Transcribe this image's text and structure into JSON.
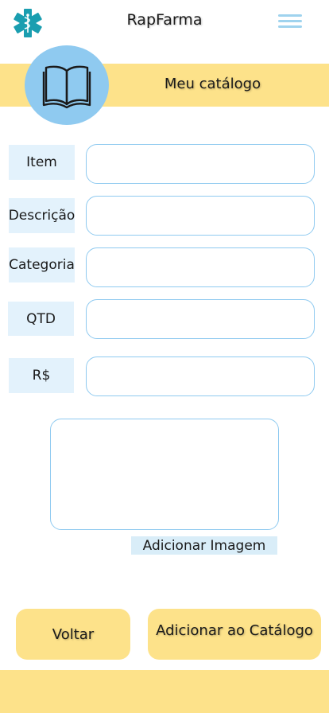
{
  "header": {
    "app_title": "RapFarma",
    "logo_icon": "medical-star-icon",
    "menu_icon": "hamburger-menu-icon"
  },
  "banner": {
    "title": "Meu catálogo",
    "avatar_icon": "open-book-icon"
  },
  "form": {
    "fields": [
      {
        "label": "Item",
        "value": "",
        "placeholder": ""
      },
      {
        "label": "Descrição",
        "value": "",
        "placeholder": ""
      },
      {
        "label": "Categoria",
        "value": "",
        "placeholder": ""
      },
      {
        "label": "QTD",
        "value": "",
        "placeholder": ""
      },
      {
        "label": "R$",
        "value": "",
        "placeholder": ""
      }
    ]
  },
  "image": {
    "button_label": "Adicionar Imagem"
  },
  "actions": {
    "back_label": "Voltar",
    "add_label": "Adicionar ao Catálogo"
  },
  "colors": {
    "accent_yellow": "#fde28a",
    "accent_blue": "#8fcaf0",
    "logo_teal": "#1a9eb0"
  }
}
